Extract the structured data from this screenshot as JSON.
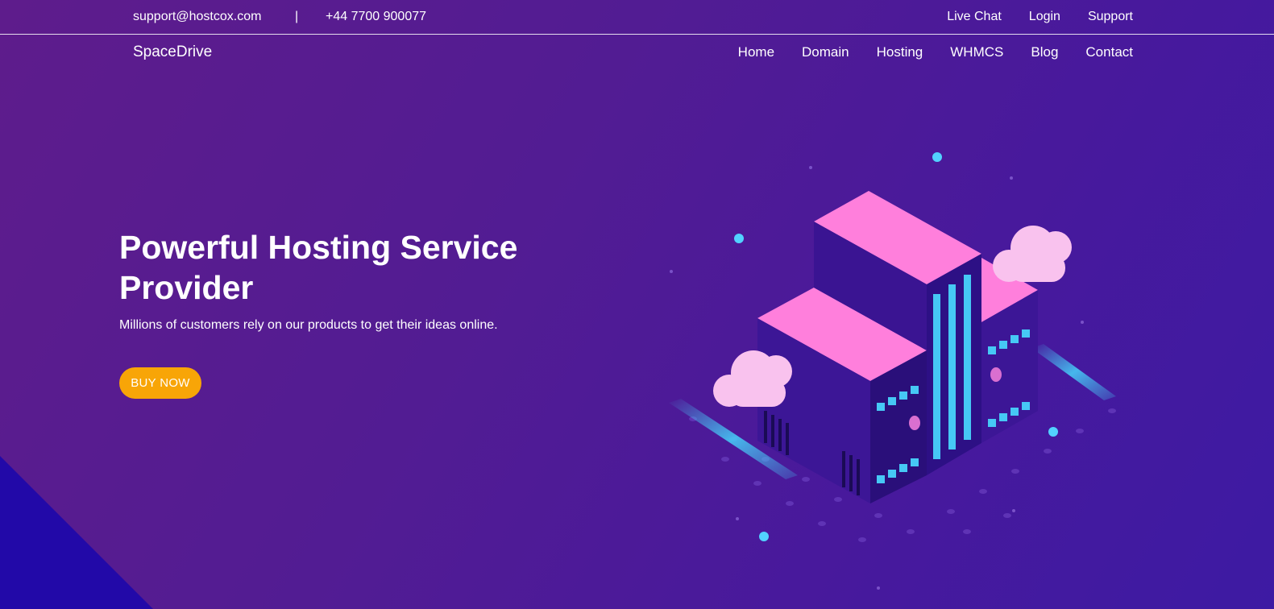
{
  "topbar": {
    "email": "support@hostcox.com",
    "separator": "|",
    "phone": "+44 7700 900077",
    "links": [
      "Live Chat",
      "Login",
      "Support"
    ]
  },
  "nav": {
    "brand": "SpaceDrive",
    "items": [
      "Home",
      "Domain",
      "Hosting",
      "WHMCS",
      "Blog",
      "Contact"
    ]
  },
  "hero": {
    "title": "Powerful Hosting Service Provider",
    "subtitle": "Millions of customers rely on our products to get their ideas online.",
    "button_label": "BUY NOW"
  },
  "colors": {
    "button": "#f8a507",
    "corner": "#2209a8",
    "building_top": "#ff7fdc",
    "window": "#46c8f5"
  }
}
